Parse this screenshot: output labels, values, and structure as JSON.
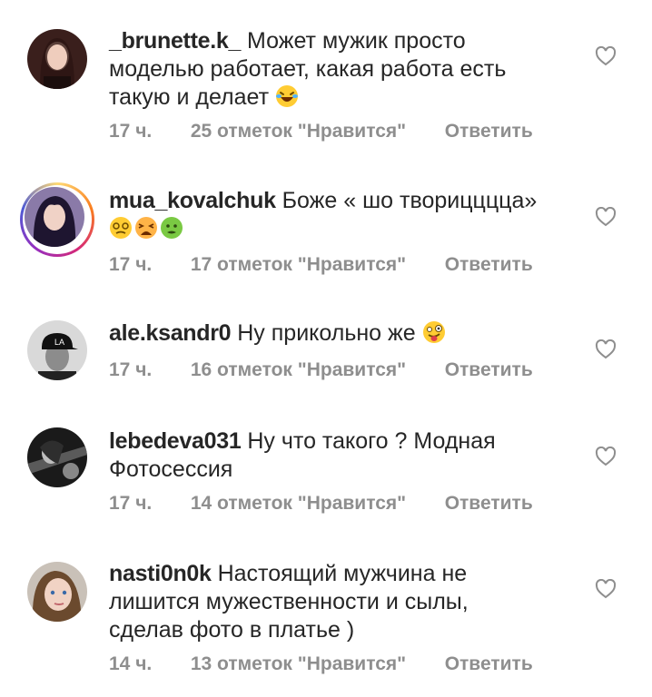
{
  "comments": [
    {
      "username": "_brunette.k_",
      "text": "Может мужик просто моделью работает, какая работа есть такую и делает",
      "emojis": [
        "laughing-tears"
      ],
      "time": "17 ч.",
      "likes": "25 отметок \"Нравится\"",
      "reply": "Ответить",
      "has_story_ring": false
    },
    {
      "username": "mua_kovalchuk",
      "text": "Боже « шо творицццца»",
      "emojis": [
        "dizzy-face",
        "tired-face",
        "nauseated-face"
      ],
      "time": "17 ч.",
      "likes": "17 отметок \"Нравится\"",
      "reply": "Ответить",
      "has_story_ring": true
    },
    {
      "username": "ale.ksandr0",
      "text": "Ну прикольно же",
      "emojis": [
        "winking-tongue-face"
      ],
      "time": "17 ч.",
      "likes": "16 отметок \"Нравится\"",
      "reply": "Ответить",
      "has_story_ring": false
    },
    {
      "username": "lebedeva031",
      "text": "Ну что такого ? Модная Фотосессия",
      "emojis": [],
      "time": "17 ч.",
      "likes": "14 отметок \"Нравится\"",
      "reply": "Ответить",
      "has_story_ring": false
    },
    {
      "username": "nasti0n0k",
      "text": "Настоящий мужчина не лишится мужественности и сылы, сделав фото в платье )",
      "emojis": [],
      "time": "14 ч.",
      "likes": "13 отметок \"Нравится\"",
      "reply": "Ответить",
      "has_story_ring": false
    }
  ],
  "icons": {
    "like": "heart-outline-icon"
  },
  "colors": {
    "text": "#262626",
    "meta": "#8e8e8e"
  }
}
